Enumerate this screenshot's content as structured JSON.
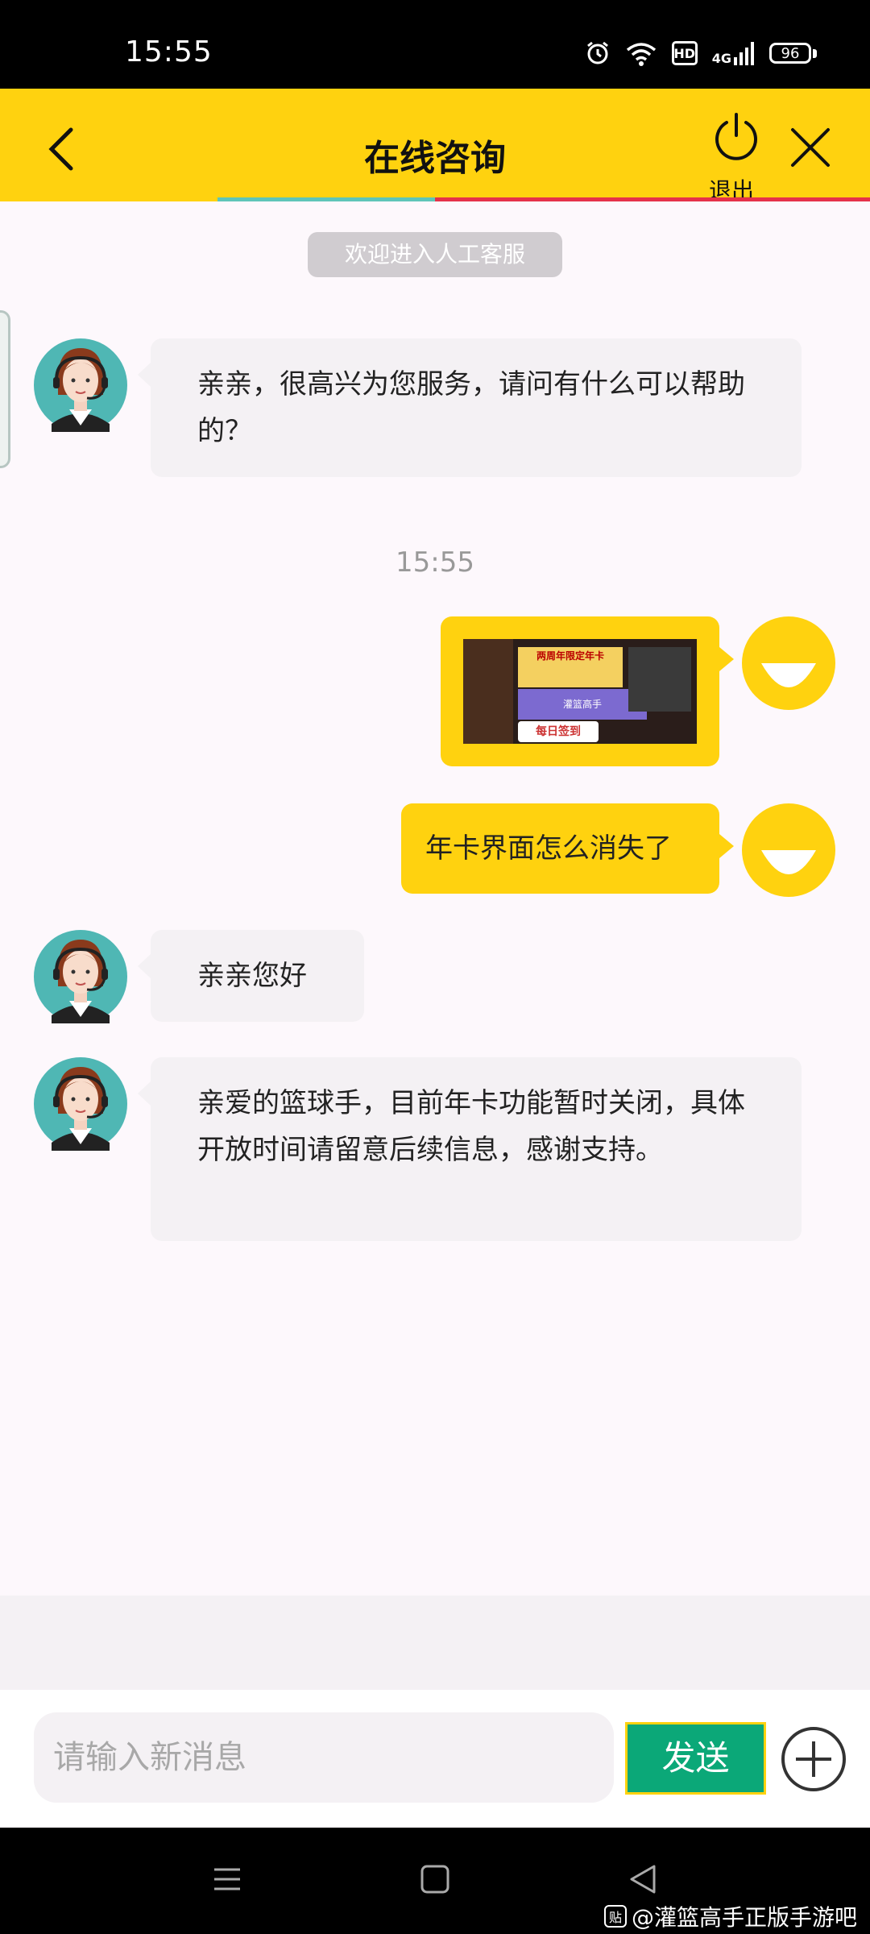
{
  "status_bar": {
    "time": "15:55",
    "network": "4G",
    "hd": "HD",
    "battery": "96"
  },
  "header": {
    "title": "在线咨询",
    "logout_label": "退出"
  },
  "notice": "欢迎进入人工客服",
  "timestamp": "15:55",
  "messages": [
    {
      "side": "left",
      "text": "亲亲，很高兴为您服务，请问有什么可以帮助的？"
    },
    {
      "side": "right",
      "type": "image"
    },
    {
      "side": "right",
      "text": "年卡界面怎么消失了"
    },
    {
      "side": "left",
      "text": "亲亲您好"
    },
    {
      "side": "left",
      "text": "亲爱的篮球手，目前年卡功能暂时关闭，具体开放时间请留意后续信息，感谢支持。"
    }
  ],
  "thumb_texts": {
    "banner1": "两周年限定年卡",
    "banner2": "灌篮高手",
    "banner3": "每日签到"
  },
  "input": {
    "placeholder": "请输入新消息",
    "send_label": "发送"
  },
  "watermark": "@灌篮高手正版手游吧",
  "colors": {
    "header_yellow": "#ffd20f",
    "send_green": "#0ba878",
    "bubble_gray": "#f4f1f4"
  },
  "icons": [
    "back-icon",
    "power-icon",
    "close-icon",
    "plus-icon",
    "menu-icon",
    "home-icon",
    "back-nav-icon"
  ]
}
